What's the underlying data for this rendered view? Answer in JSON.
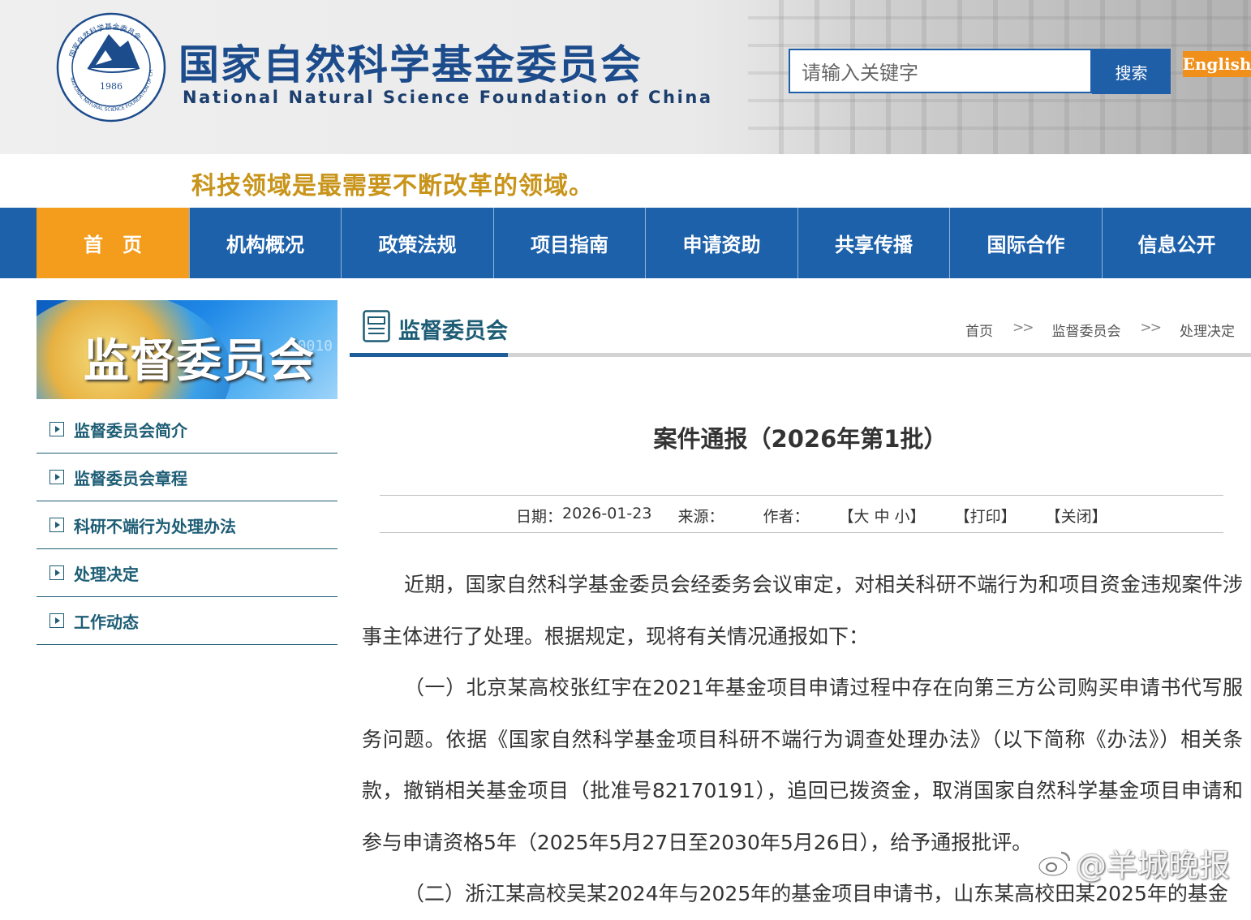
{
  "header": {
    "title_cn": "国家自然科学基金委员会",
    "title_en": "National Natural Science Foundation of China",
    "seal_year": "1986",
    "search_placeholder": "请输入关键字",
    "search_button": "搜索",
    "english_link": "English"
  },
  "slogan": "科技领域是最需要不断改革的领域。",
  "nav": {
    "items": [
      "首　页",
      "机构概况",
      "政策法规",
      "项目指南",
      "申请资助",
      "共享传播",
      "国际合作",
      "信息公开"
    ],
    "active_index": 0
  },
  "sidebar": {
    "banner_text": "监督委员会",
    "items": [
      "监督委员会简介",
      "监督委员会章程",
      "科研不端行为处理办法",
      "处理决定",
      "工作动态"
    ]
  },
  "section": {
    "title": "监督委员会",
    "breadcrumb": [
      "首页",
      ">>",
      "监督委员会",
      ">>",
      "处理决定"
    ]
  },
  "article": {
    "title": "案件通报（2026年第1批）",
    "date_label": "日期：",
    "date": "2026-01-23",
    "source_label": "来源：",
    "author_label": "作者：",
    "font_size_links": "【大 中 小】",
    "print_link": "【打印】",
    "close_link": "【关闭】",
    "paragraphs": [
      "近期，国家自然科学基金委员会经委务会议审定，对相关科研不端行为和项目资金违规案件涉事主体进行了处理。根据规定，现将有关情况通报如下：",
      "（一）北京某高校张红宇在2021年基金项目申请过程中存在向第三方公司购买申请书代写服务问题。依据《国家自然科学基金项目科研不端行为调查处理办法》（以下简称《办法》）相关条款，撤销相关基金项目（批准号82170191），追回已拨资金，取消国家自然科学基金项目申请和参与申请资格5年（2025年5月27日至2030年5月26日），给予通报批评。",
      "（二）浙江某高校吴某2024年与2025年的基金项目申请书，山东某高校田某2025年的基金"
    ]
  },
  "watermark": "@羊城晚报",
  "colors": {
    "brand_blue": "#1d61ab",
    "nav_active": "#f49c1b",
    "slogan_gold": "#c8941a",
    "sidebar_teal": "#1d5d75"
  }
}
